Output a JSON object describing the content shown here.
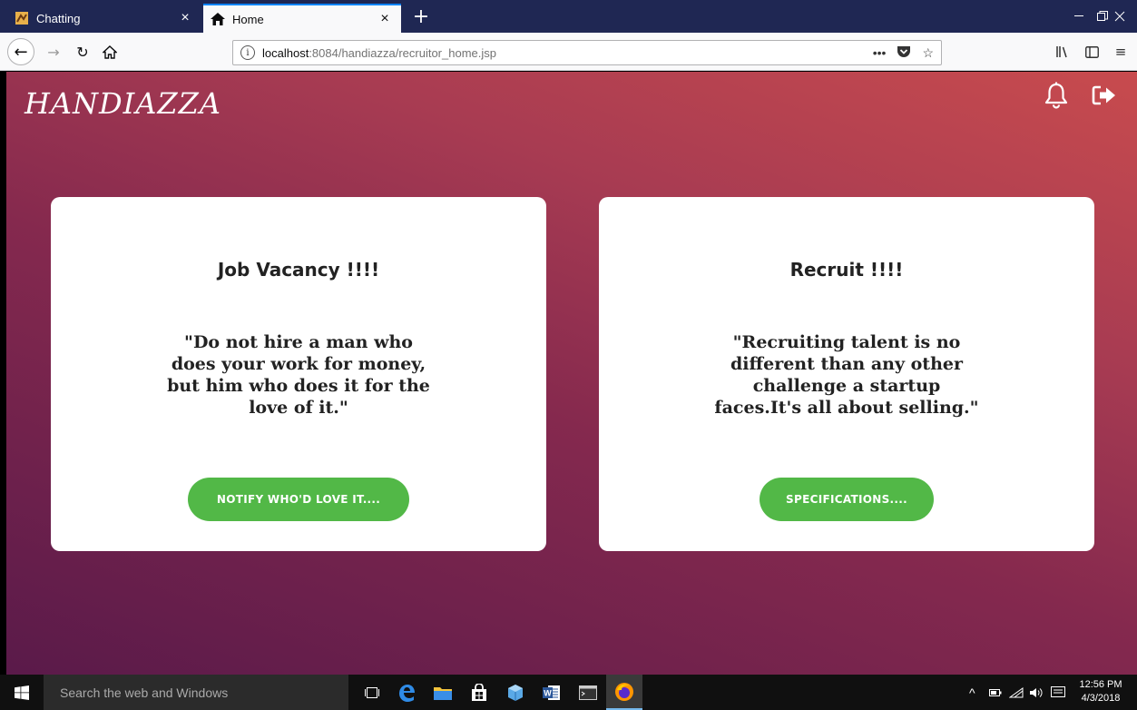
{
  "browser": {
    "tabs": [
      {
        "title": "Chatting",
        "favicon": "chat-app-icon",
        "active": false
      },
      {
        "title": "Home",
        "favicon": "home-icon",
        "active": true
      }
    ],
    "url_host": "localhost",
    "url_path": ":8084/handiazza/recruitor_home.jsp"
  },
  "app": {
    "brand": "HANDIAZZA",
    "header_icons": [
      "bell-icon",
      "logout-icon"
    ]
  },
  "cards": [
    {
      "title": "Job Vacancy !!!!",
      "quote": "\"Do not hire a man who does your work for money, but him who does it for the love of it.\"",
      "button_label": "NOTIFY WHO'D LOVE IT...."
    },
    {
      "title": "Recruit !!!!",
      "quote": "\"Recruiting talent is no different than any other challenge a startup faces.It's all about selling.\"",
      "button_label": "SPECIFICATIONS...."
    }
  ],
  "taskbar": {
    "search_placeholder": "Search the web and Windows",
    "time": "12:56 PM",
    "date": "4/3/2018"
  },
  "colors": {
    "accent_button": "#52b847",
    "tab_bar": "#1f2753"
  }
}
